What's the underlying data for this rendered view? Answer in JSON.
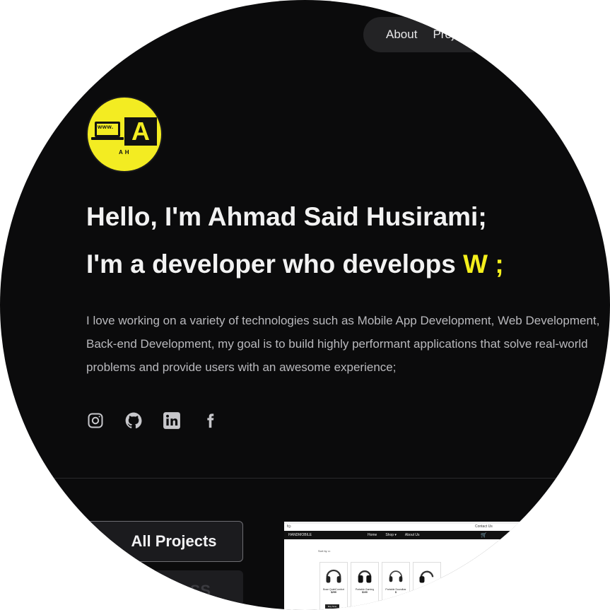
{
  "nav": {
    "items": [
      "About",
      "Projects"
    ]
  },
  "logo": {
    "www": "www.",
    "letter": "A",
    "initials": "AH"
  },
  "hero": {
    "greeting": "Hello, I'm Ahmad Said Husirami;",
    "dev_prefix": "I'm a developer who develops ",
    "dev_typed": "W ;",
    "intro": "I love working on a variety of technologies such as Mobile App Development, Web Development, Back-end Development, my goal is to build highly performant applications that solve real-world problems and provide users with an awesome experience;"
  },
  "socials": [
    "instagram-icon",
    "github-icon",
    "linkedin-icon",
    "facebook-icon"
  ],
  "filters": {
    "all_label": "All Projects",
    "second_label": "SS"
  },
  "preview": {
    "brand": "HANDMOBILE",
    "links": [
      "Home",
      "Shop ▾",
      "About Us"
    ],
    "contact": "Contact Us",
    "sort": "Sort by",
    "products": [
      {
        "name": "Bose QuietComfort",
        "price": "$299"
      },
      {
        "name": "Portable Gaming",
        "price": "$100"
      },
      {
        "name": "Portable Soundbar",
        "price": "$"
      },
      {
        "name": "",
        "price": ""
      }
    ],
    "buy_label": "Buy Now"
  },
  "colors": {
    "background": "#0b0b0c",
    "accent": "#f4ef1c",
    "text": "#f2f2f2",
    "muted": "#b9b9bd"
  }
}
